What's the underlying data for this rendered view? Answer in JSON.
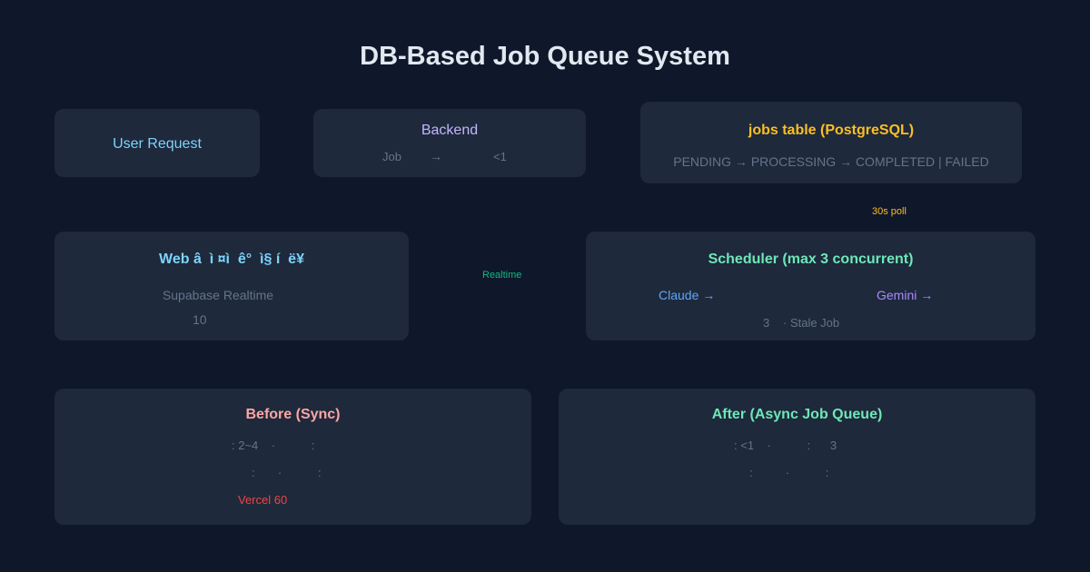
{
  "title": "DB-Based Job Queue System",
  "colors": {
    "background": "#0f172a",
    "card": "#1e293b",
    "title": "#e2e8f0",
    "blue": "#7dd3fc",
    "purple": "#c4b5fd",
    "yellow": "#fbbf24",
    "green": "#6ee7b7",
    "teal": "#10b981",
    "red_light": "#fca5a5",
    "red": "#ef4444",
    "muted": "#64748b",
    "claude": "#60a5fa",
    "gemini": "#a78bfa"
  },
  "user_request": {
    "label": "User Request"
  },
  "backend": {
    "title": "Backend",
    "job": "Job",
    "arrow": "→",
    "time": "<1"
  },
  "jobs_table": {
    "title": "jobs table (PostgreSQL)",
    "states": "PENDING → PROCESSING → COMPLETED | FAILED"
  },
  "poll_label": "30s poll",
  "realtime_label": "Realtime",
  "web": {
    "title": "Web â  ì ¤ì  ê°  ì§ í  ë¥",
    "line1": "Supabase Realtime",
    "line2": "10"
  },
  "scheduler": {
    "title": "Scheduler (max 3 concurrent)",
    "claude": "Claude →",
    "gemini": "Gemini →",
    "line3_num": "3",
    "line3_text": "· Stale Job"
  },
  "before": {
    "title": "Before (Sync)",
    "line1": ": 2~4    ·           :",
    "line2": ":       ·           :",
    "line3": "Vercel 60"
  },
  "after": {
    "title": "After (Async Job Queue)",
    "line1": ": <1    ·           :      3",
    "line2": ":          ·           :"
  }
}
